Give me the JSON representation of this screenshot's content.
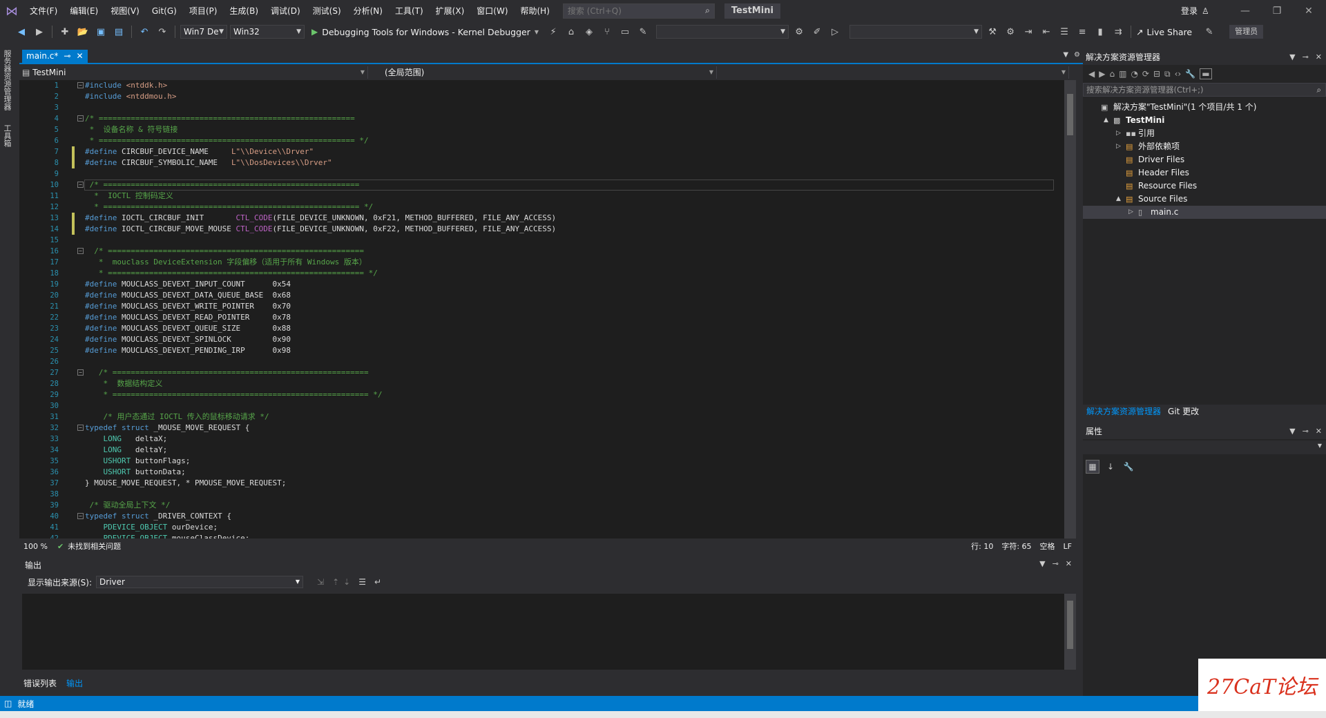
{
  "menu": [
    "文件(F)",
    "编辑(E)",
    "视图(V)",
    "Git(G)",
    "项目(P)",
    "生成(B)",
    "调试(D)",
    "测试(S)",
    "分析(N)",
    "工具(T)",
    "扩展(X)",
    "窗口(W)",
    "帮助(H)"
  ],
  "search": {
    "placeholder": "搜索 (Ctrl+Q)"
  },
  "solution_name": "TestMini",
  "login_label": "登录",
  "toolbar": {
    "os_combo": "Win7 De",
    "platform_combo": "Win32",
    "debugger_label": "Debugging Tools for Windows - Kernel Debugger",
    "live_share": "Live Share",
    "admin": "管理员"
  },
  "left_strip": [
    "服务器资源管理器",
    "工具箱"
  ],
  "editor": {
    "tab_label": "main.c*",
    "nav_project": "TestMini",
    "nav_scope": "(全局范围)",
    "zoom": "100 %",
    "issues": "未找到相关问题",
    "row": "行: 10",
    "col": "字符: 65",
    "spaces": "空格",
    "eol": "LF",
    "lines": [
      {
        "n": "1",
        "t": "#include <ntddk.h>"
      },
      {
        "n": "2",
        "t": "#include <ntddmou.h>"
      },
      {
        "n": "3",
        "t": ""
      },
      {
        "n": "4",
        "t": "/* ========================================================"
      },
      {
        "n": "5",
        "t": " *  设备名称 & 符号链接"
      },
      {
        "n": "6",
        "t": " * ======================================================== */"
      },
      {
        "n": "7",
        "t": "#define CIRCBUF_DEVICE_NAME     L\"\\\\Device\\\\Drver\""
      },
      {
        "n": "8",
        "t": "#define CIRCBUF_SYMBOLIC_NAME   L\"\\\\DosDevices\\\\Drver\""
      },
      {
        "n": "9",
        "t": ""
      },
      {
        "n": "10",
        "t": " /* ========================================================"
      },
      {
        "n": "11",
        "t": "  *  IOCTL 控制码定义"
      },
      {
        "n": "12",
        "t": "  * ======================================================== */"
      },
      {
        "n": "13",
        "t": "#define IOCTL_CIRCBUF_INIT       CTL_CODE(FILE_DEVICE_UNKNOWN, 0xF21, METHOD_BUFFERED, FILE_ANY_ACCESS)"
      },
      {
        "n": "14",
        "t": "#define IOCTL_CIRCBUF_MOVE_MOUSE CTL_CODE(FILE_DEVICE_UNKNOWN, 0xF22, METHOD_BUFFERED, FILE_ANY_ACCESS)"
      },
      {
        "n": "15",
        "t": ""
      },
      {
        "n": "16",
        "t": "  /* ========================================================"
      },
      {
        "n": "17",
        "t": "   *  mouclass DeviceExtension 字段偏移（适用于所有 Windows 版本）"
      },
      {
        "n": "18",
        "t": "   * ======================================================== */"
      },
      {
        "n": "19",
        "t": "#define MOUCLASS_DEVEXT_INPUT_COUNT      0x54"
      },
      {
        "n": "20",
        "t": "#define MOUCLASS_DEVEXT_DATA_QUEUE_BASE  0x68"
      },
      {
        "n": "21",
        "t": "#define MOUCLASS_DEVEXT_WRITE_POINTER    0x70"
      },
      {
        "n": "22",
        "t": "#define MOUCLASS_DEVEXT_READ_POINTER     0x78"
      },
      {
        "n": "23",
        "t": "#define MOUCLASS_DEVEXT_QUEUE_SIZE       0x88"
      },
      {
        "n": "24",
        "t": "#define MOUCLASS_DEVEXT_SPINLOCK         0x90"
      },
      {
        "n": "25",
        "t": "#define MOUCLASS_DEVEXT_PENDING_IRP      0x98"
      },
      {
        "n": "26",
        "t": ""
      },
      {
        "n": "27",
        "t": "   /* ========================================================"
      },
      {
        "n": "28",
        "t": "    *  数据结构定义"
      },
      {
        "n": "29",
        "t": "    * ======================================================== */"
      },
      {
        "n": "30",
        "t": ""
      },
      {
        "n": "31",
        "t": "    /* 用户态通过 IOCTL 传入的鼠标移动请求 */"
      },
      {
        "n": "32",
        "t": "typedef struct _MOUSE_MOVE_REQUEST {"
      },
      {
        "n": "33",
        "t": "    LONG   deltaX;"
      },
      {
        "n": "34",
        "t": "    LONG   deltaY;"
      },
      {
        "n": "35",
        "t": "    USHORT buttonFlags;"
      },
      {
        "n": "36",
        "t": "    USHORT buttonData;"
      },
      {
        "n": "37",
        "t": "} MOUSE_MOVE_REQUEST, * PMOUSE_MOVE_REQUEST;"
      },
      {
        "n": "38",
        "t": ""
      },
      {
        "n": "39",
        "t": " /* 驱动全局上下文 */"
      },
      {
        "n": "40",
        "t": "typedef struct _DRIVER_CONTEXT {"
      },
      {
        "n": "41",
        "t": "    PDEVICE_OBJECT ourDevice;"
      },
      {
        "n": "42",
        "t": "    PDEVICE_OBJECT mouseClassDevice;"
      }
    ]
  },
  "output": {
    "title": "输出",
    "source_label": "显示输出来源(S):",
    "source_value": "Driver"
  },
  "bottom_tabs": [
    "错误列表",
    "输出"
  ],
  "solution_explorer": {
    "title": "解决方案资源管理器",
    "search_placeholder": "搜索解决方案资源管理器(Ctrl+;)",
    "tree": [
      {
        "label": "解决方案\"TestMini\"(1 个项目/共 1 个)",
        "indent": 0,
        "exp": "",
        "icon": "solution-icon"
      },
      {
        "label": "TestMini",
        "indent": 1,
        "exp": "▲",
        "icon": "project-icon"
      },
      {
        "label": "引用",
        "indent": 2,
        "exp": "▷",
        "icon": "references-icon"
      },
      {
        "label": "外部依赖项",
        "indent": 2,
        "exp": "▷",
        "icon": "external-deps-icon"
      },
      {
        "label": "Driver Files",
        "indent": 2,
        "exp": "",
        "icon": "filter-folder-icon"
      },
      {
        "label": "Header Files",
        "indent": 2,
        "exp": "",
        "icon": "filter-folder-icon"
      },
      {
        "label": "Resource Files",
        "indent": 2,
        "exp": "",
        "icon": "filter-folder-icon"
      },
      {
        "label": "Source Files",
        "indent": 2,
        "exp": "▲",
        "icon": "filter-folder-icon"
      },
      {
        "label": "main.c",
        "indent": 3,
        "exp": "▷",
        "icon": "c-file-icon"
      }
    ],
    "tabs": [
      "解决方案资源管理器",
      "Git 更改"
    ]
  },
  "properties": {
    "title": "属性"
  },
  "status": {
    "text": "就绪"
  },
  "watermark": "27CaT论坛",
  "colors": {
    "accent": "#007acc",
    "editor_bg": "#1e1e1e",
    "chrome_bg": "#2d2d30"
  }
}
